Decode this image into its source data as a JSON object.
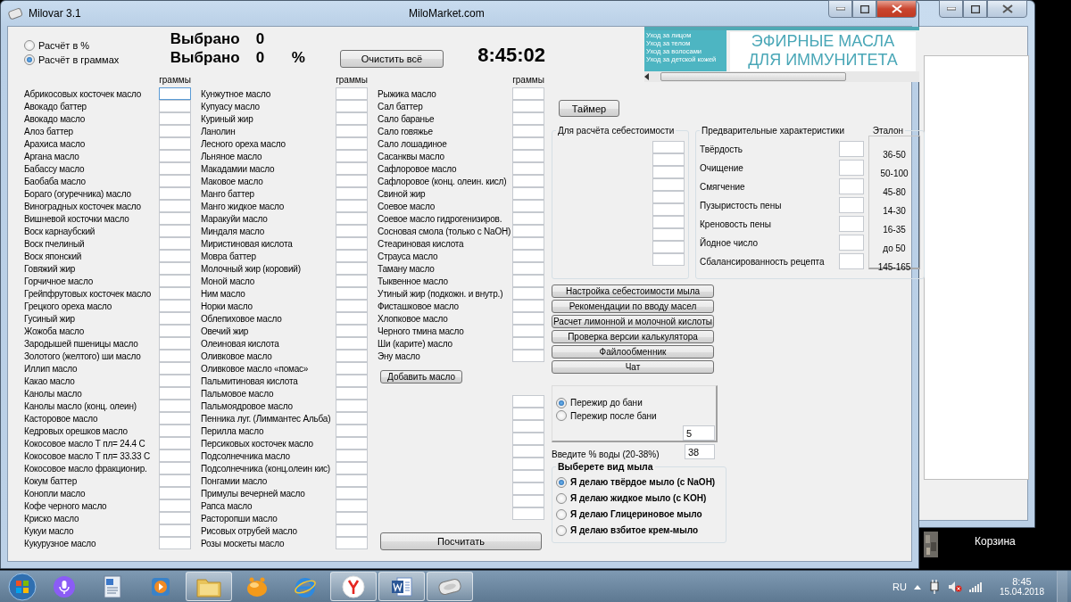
{
  "window": {
    "title": "Milovar 3.1",
    "site": "MiloMarket.com"
  },
  "mode_options": [
    {
      "label": "Расчёт в %",
      "selected": false
    },
    {
      "label": "Расчёт в граммах",
      "selected": true
    }
  ],
  "selected_summary": [
    {
      "label": "Выбрано",
      "value": "0"
    },
    {
      "label": "Выбрано",
      "value": "0",
      "unit": "%"
    }
  ],
  "clear_button": "Очистить всё",
  "clock": "8:45:02",
  "ad": {
    "menu": [
      "Уход за лицом",
      "Уход за телом",
      "Уход за волосами",
      "Уход за детской кожей"
    ],
    "headline": [
      "ЭФИРНЫЕ МАСЛА",
      "ДЛЯ ИММУНИТЕТА"
    ]
  },
  "oil_columns": [
    {
      "header": "граммы",
      "oils": [
        "Абрикосовых косточек масло",
        "Авокадо баттер",
        "Авокадо масло",
        "Алоэ баттер",
        "Арахиса масло",
        "Аргана масло",
        "Бабассу масло",
        "Баобаба масло",
        "Бораго (огуречника) масло",
        "Виноградных косточек масло",
        "Вишневой косточки масло",
        "Воск карнаубский",
        "Воск пчелиный",
        "Воск японский",
        "Говяжий жир",
        "Горчичное масло",
        "Грейпфрутовых косточек масло",
        "Грецкого ореха масло",
        "Гусиный жир",
        "Жожоба масло",
        "Зародышей пшеницы масло",
        "Золотого (желтого) ши масло",
        "Иллип масло",
        "Какао масло",
        "Канолы масло",
        "Канолы масло  (конц. олеин)",
        "Касторовое масло",
        "Кедровых орешков масло",
        "Кокосовое масло Т пл= 24.4 С",
        "Кокосовое масло Т пл= 33.33 С",
        "Кокосовое масло фракционир.",
        "Кокум баттер",
        "Конопли масло",
        "Кофе черного масло",
        "Криско масло",
        "Кукуи масло",
        "Кукурузное масло"
      ]
    },
    {
      "header": "граммы",
      "oils": [
        "Кунжутное масло",
        "Купуасу масло",
        "Куриный жир",
        "Ланолин",
        "Лесного ореха масло",
        "Льняное масло",
        "Макадамии масло",
        "Маковое масло",
        "Манго баттер",
        "Манго жидкое масло",
        "Маракуйи масло",
        "Миндаля масло",
        "Миристиновая кислота",
        "Мовра баттер",
        "Молочный жир (коровий)",
        "Моной масло",
        "Ним масло",
        "Норки масло",
        "Облепиховое масло",
        "Овечий жир",
        "Олеиновая кислота",
        "Оливковое масло",
        "Оливковое масло «помас»",
        "Пальмитиновая кислота",
        "Пальмовое масло",
        "Пальмоядровое масло",
        "Пенника луг. (Лиммантес Альба)",
        "Перилла масло",
        "Персиковых косточек масло",
        "Подсолнечника масло",
        "Подсолнечника (конц.олеин кис)",
        "Понгамии масло",
        "Примулы вечерней масло",
        "Рапса масло",
        "Расторопши масло",
        "Рисовых отрубей масло",
        "Розы москеты масло"
      ]
    },
    {
      "header": "граммы",
      "oils": [
        "Рыжика масло",
        "Сал баттер",
        "Сало баранье",
        "Сало говяжье",
        "Сало лошадиное",
        "Сасанквы масло",
        "Сафлоровое масло",
        "Сафлоровое (конц. олеин. кисл)",
        "Свиной жир",
        "Соевое масло",
        "Соевое масло гидрогенизиров.",
        "Сосновая смола (только с NaOH)",
        "Стеариновая кислота",
        "Страуса масло",
        "Таману масло",
        "Тыквенное масло",
        "Утиный жир (подкожн. и внутр.)",
        "Фисташковое масло",
        "Хлопковое масло",
        "Черного тмина масло",
        "Ши (карите) масло",
        "Эну масло"
      ]
    }
  ],
  "add_oil_button": "Добавить масло",
  "calculate_button": "Посчитать",
  "timer_button": "Таймер",
  "cost_group": {
    "title": "Для расчёта себестоимости"
  },
  "characteristics": {
    "title": "Предварительные характеристики",
    "standard_header": "Эталон",
    "rows": [
      {
        "label": "Твёрдость",
        "standard": "36-50"
      },
      {
        "label": "Очищение",
        "standard": "50-100"
      },
      {
        "label": "Смягчение",
        "standard": "45-80"
      },
      {
        "label": "Пузыристость пены",
        "standard": "14-30"
      },
      {
        "label": "Креновость пены",
        "standard": "16-35"
      },
      {
        "label": "Йодное число",
        "standard": "до 50"
      },
      {
        "label": "Сбалансированность рецепта",
        "standard": "145-165"
      }
    ]
  },
  "actions": [
    "Настройка себестоимости мыла",
    "Рекомендации по вводу масел",
    "Расчет лимонной  и молочной кислоты",
    "Проверка версии калькулятора",
    "Файлообменник",
    "Чат"
  ],
  "superfat": {
    "options": [
      {
        "label": "Пережир до бани",
        "selected": true
      },
      {
        "label": "Пережир после бани",
        "selected": false
      }
    ],
    "value": "5"
  },
  "water": {
    "label": "Введите % воды (20-38%)",
    "value": "38"
  },
  "soap_type": {
    "title": "Выберете вид мыла",
    "options": [
      {
        "label": "Я делаю твёрдое мыло (с NaOH)",
        "selected": true
      },
      {
        "label": "Я делаю жидкое мыло (с KOH)",
        "selected": false
      },
      {
        "label": "Я делаю Глицериновое мыло",
        "selected": false
      },
      {
        "label": "Я делаю взбитое крем-мыло",
        "selected": false
      }
    ]
  },
  "desktop": {
    "icon_label": "Корзина"
  },
  "taskbar": {
    "apps": [
      {
        "kind": "microphone",
        "running": false
      },
      {
        "kind": "document",
        "running": false
      },
      {
        "kind": "media",
        "running": false
      },
      {
        "kind": "folder",
        "running": true
      },
      {
        "kind": "ball",
        "running": false
      },
      {
        "kind": "browser",
        "running": false
      },
      {
        "kind": "yandex",
        "running": true
      },
      {
        "kind": "word",
        "running": true
      },
      {
        "kind": "soap",
        "running": true
      }
    ],
    "language": "RU",
    "time": "8:45",
    "date": "15.04.2018"
  }
}
